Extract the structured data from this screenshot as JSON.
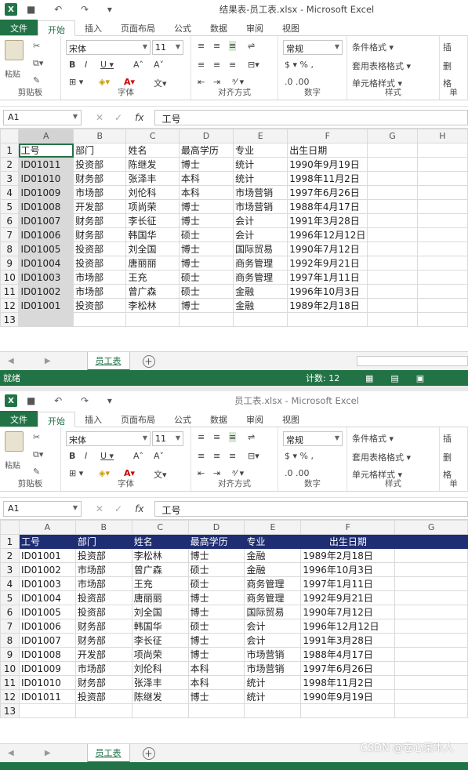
{
  "brand_color": "#217346",
  "header_fill_color": "#1f2d73",
  "windows": [
    {
      "title": "结果表-员工表.xlsx - Microsoft Excel",
      "tabs": [
        "文件",
        "开始",
        "插入",
        "页面布局",
        "公式",
        "数据",
        "审阅",
        "视图"
      ],
      "ribbon": {
        "paste": "粘贴",
        "font_name": "宋体",
        "font_size": "11",
        "number_format": "常规",
        "style_items": [
          "条件格式 ▾",
          "套用表格格式 ▾",
          "单元格样式 ▾"
        ],
        "cell_items": [
          "插",
          "删",
          "格"
        ],
        "group_labels": [
          "剪贴板",
          "字体",
          "对齐方式",
          "数字",
          "样式",
          "单"
        ]
      },
      "name_box": "A1",
      "formula": "工号",
      "columns": [
        "A",
        "B",
        "C",
        "D",
        "E",
        "F",
        "G",
        "H"
      ],
      "rows": [
        [
          "工号",
          "部门",
          "姓名",
          "最高学历",
          "专业",
          "出生日期"
        ],
        [
          "ID01011",
          "投资部",
          "陈继发",
          "博士",
          "统计",
          "1990年9月19日"
        ],
        [
          "ID01010",
          "财务部",
          "张泽丰",
          "本科",
          "统计",
          "1998年11月2日"
        ],
        [
          "ID01009",
          "市场部",
          "刘伦科",
          "本科",
          "市场营销",
          "1997年6月26日"
        ],
        [
          "ID01008",
          "开发部",
          "项尚荣",
          "博士",
          "市场营销",
          "1988年4月17日"
        ],
        [
          "ID01007",
          "财务部",
          "李长征",
          "博士",
          "会计",
          "1991年3月28日"
        ],
        [
          "ID01006",
          "财务部",
          "韩国华",
          "硕士",
          "会计",
          "1996年12月12日"
        ],
        [
          "ID01005",
          "投资部",
          "刘全国",
          "博士",
          "国际贸易",
          "1990年7月12日"
        ],
        [
          "ID01004",
          "投资部",
          "唐丽丽",
          "博士",
          "商务管理",
          "1992年9月21日"
        ],
        [
          "ID01003",
          "市场部",
          "王充",
          "硕士",
          "商务管理",
          "1997年1月11日"
        ],
        [
          "ID01002",
          "市场部",
          "曾广森",
          "硕士",
          "金融",
          "1996年10月3日"
        ],
        [
          "ID01001",
          "投资部",
          "李松林",
          "博士",
          "金融",
          "1989年2月18日"
        ],
        [
          "",
          "",
          "",
          "",
          "",
          ""
        ]
      ],
      "sheet_tab": "员工表",
      "status_left": "就绪",
      "status_count": "计数: 12"
    },
    {
      "title": "员工表.xlsx - Microsoft Excel",
      "tabs": [
        "文件",
        "开始",
        "插入",
        "页面布局",
        "公式",
        "数据",
        "审阅",
        "视图"
      ],
      "ribbon": {
        "paste": "粘贴",
        "font_name": "宋体",
        "font_size": "11",
        "number_format": "常规",
        "style_items": [
          "条件格式 ▾",
          "套用表格格式 ▾",
          "单元格样式 ▾"
        ],
        "cell_items": [
          "插",
          "删",
          "格"
        ],
        "group_labels": [
          "剪贴板",
          "字体",
          "对齐方式",
          "数字",
          "样式",
          "单"
        ]
      },
      "name_box": "A1",
      "formula": "工号",
      "columns": [
        "A",
        "B",
        "C",
        "D",
        "E",
        "F",
        "G"
      ],
      "rows": [
        [
          "工号",
          "部门",
          "姓名",
          "最高学历",
          "专业",
          "出生日期"
        ],
        [
          "ID01001",
          "投资部",
          "李松林",
          "博士",
          "金融",
          "1989年2月18日"
        ],
        [
          "ID01002",
          "市场部",
          "曾广森",
          "硕士",
          "金融",
          "1996年10月3日"
        ],
        [
          "ID01003",
          "市场部",
          "王充",
          "硕士",
          "商务管理",
          "1997年1月11日"
        ],
        [
          "ID01004",
          "投资部",
          "唐丽丽",
          "博士",
          "商务管理",
          "1992年9月21日"
        ],
        [
          "ID01005",
          "投资部",
          "刘全国",
          "博士",
          "国际贸易",
          "1990年7月12日"
        ],
        [
          "ID01006",
          "财务部",
          "韩国华",
          "硕士",
          "会计",
          "1996年12月12日"
        ],
        [
          "ID01007",
          "财务部",
          "李长征",
          "博士",
          "会计",
          "1991年3月28日"
        ],
        [
          "ID01008",
          "开发部",
          "项尚荣",
          "博士",
          "市场营销",
          "1988年4月17日"
        ],
        [
          "ID01009",
          "市场部",
          "刘伦科",
          "本科",
          "市场营销",
          "1997年6月26日"
        ],
        [
          "ID01010",
          "财务部",
          "张泽丰",
          "本科",
          "统计",
          "1998年11月2日"
        ],
        [
          "ID01011",
          "投资部",
          "陈继发",
          "博士",
          "统计",
          "1990年9月19日"
        ],
        [
          "",
          "",
          "",
          "",
          "",
          ""
        ]
      ],
      "sheet_tab": "员工表",
      "watermark": "CSDN @卷心菜本人"
    }
  ]
}
